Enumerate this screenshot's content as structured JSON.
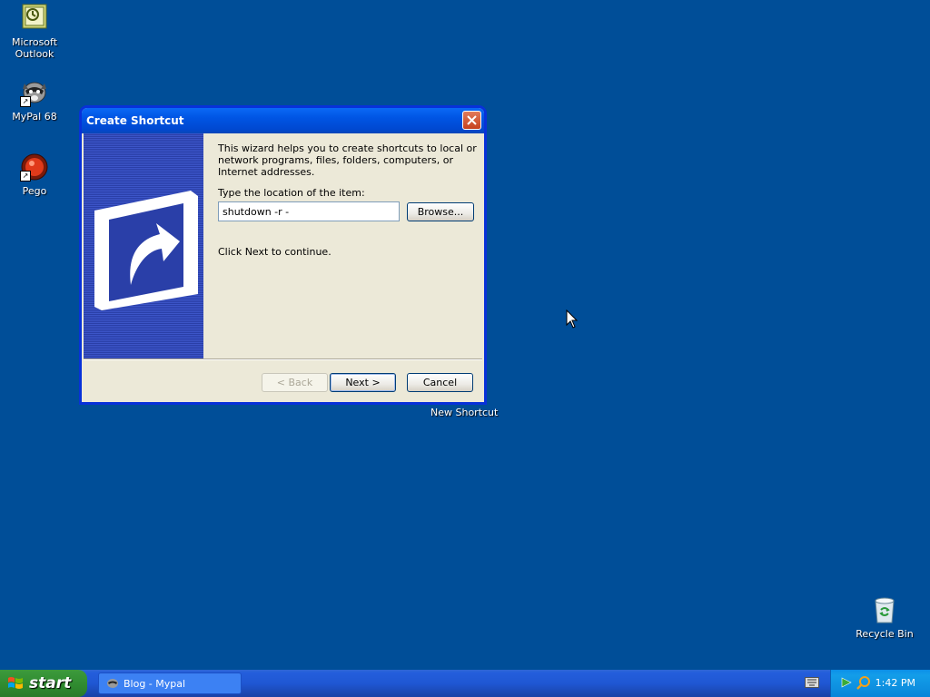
{
  "desktop": {
    "icons": [
      {
        "label": "Microsoft\nOutlook"
      },
      {
        "label": "MyPal 68"
      },
      {
        "label": "Pego"
      }
    ],
    "recycle_bin": "Recycle Bin",
    "new_shortcut_caption": "New Shortcut"
  },
  "dialog": {
    "title": "Create Shortcut",
    "intro": "This wizard helps you to create shortcuts to local or network programs, files, folders, computers, or Internet addresses.",
    "location_label": "Type the location of the item:",
    "location_value": "shutdown -r -",
    "browse_label": "Browse...",
    "continue_text": "Click Next to continue.",
    "back_label": "< Back",
    "next_label": "Next >",
    "cancel_label": "Cancel"
  },
  "taskbar": {
    "start_label": "start",
    "task_label": "Blog - Mypal",
    "clock": "1:42 PM"
  }
}
